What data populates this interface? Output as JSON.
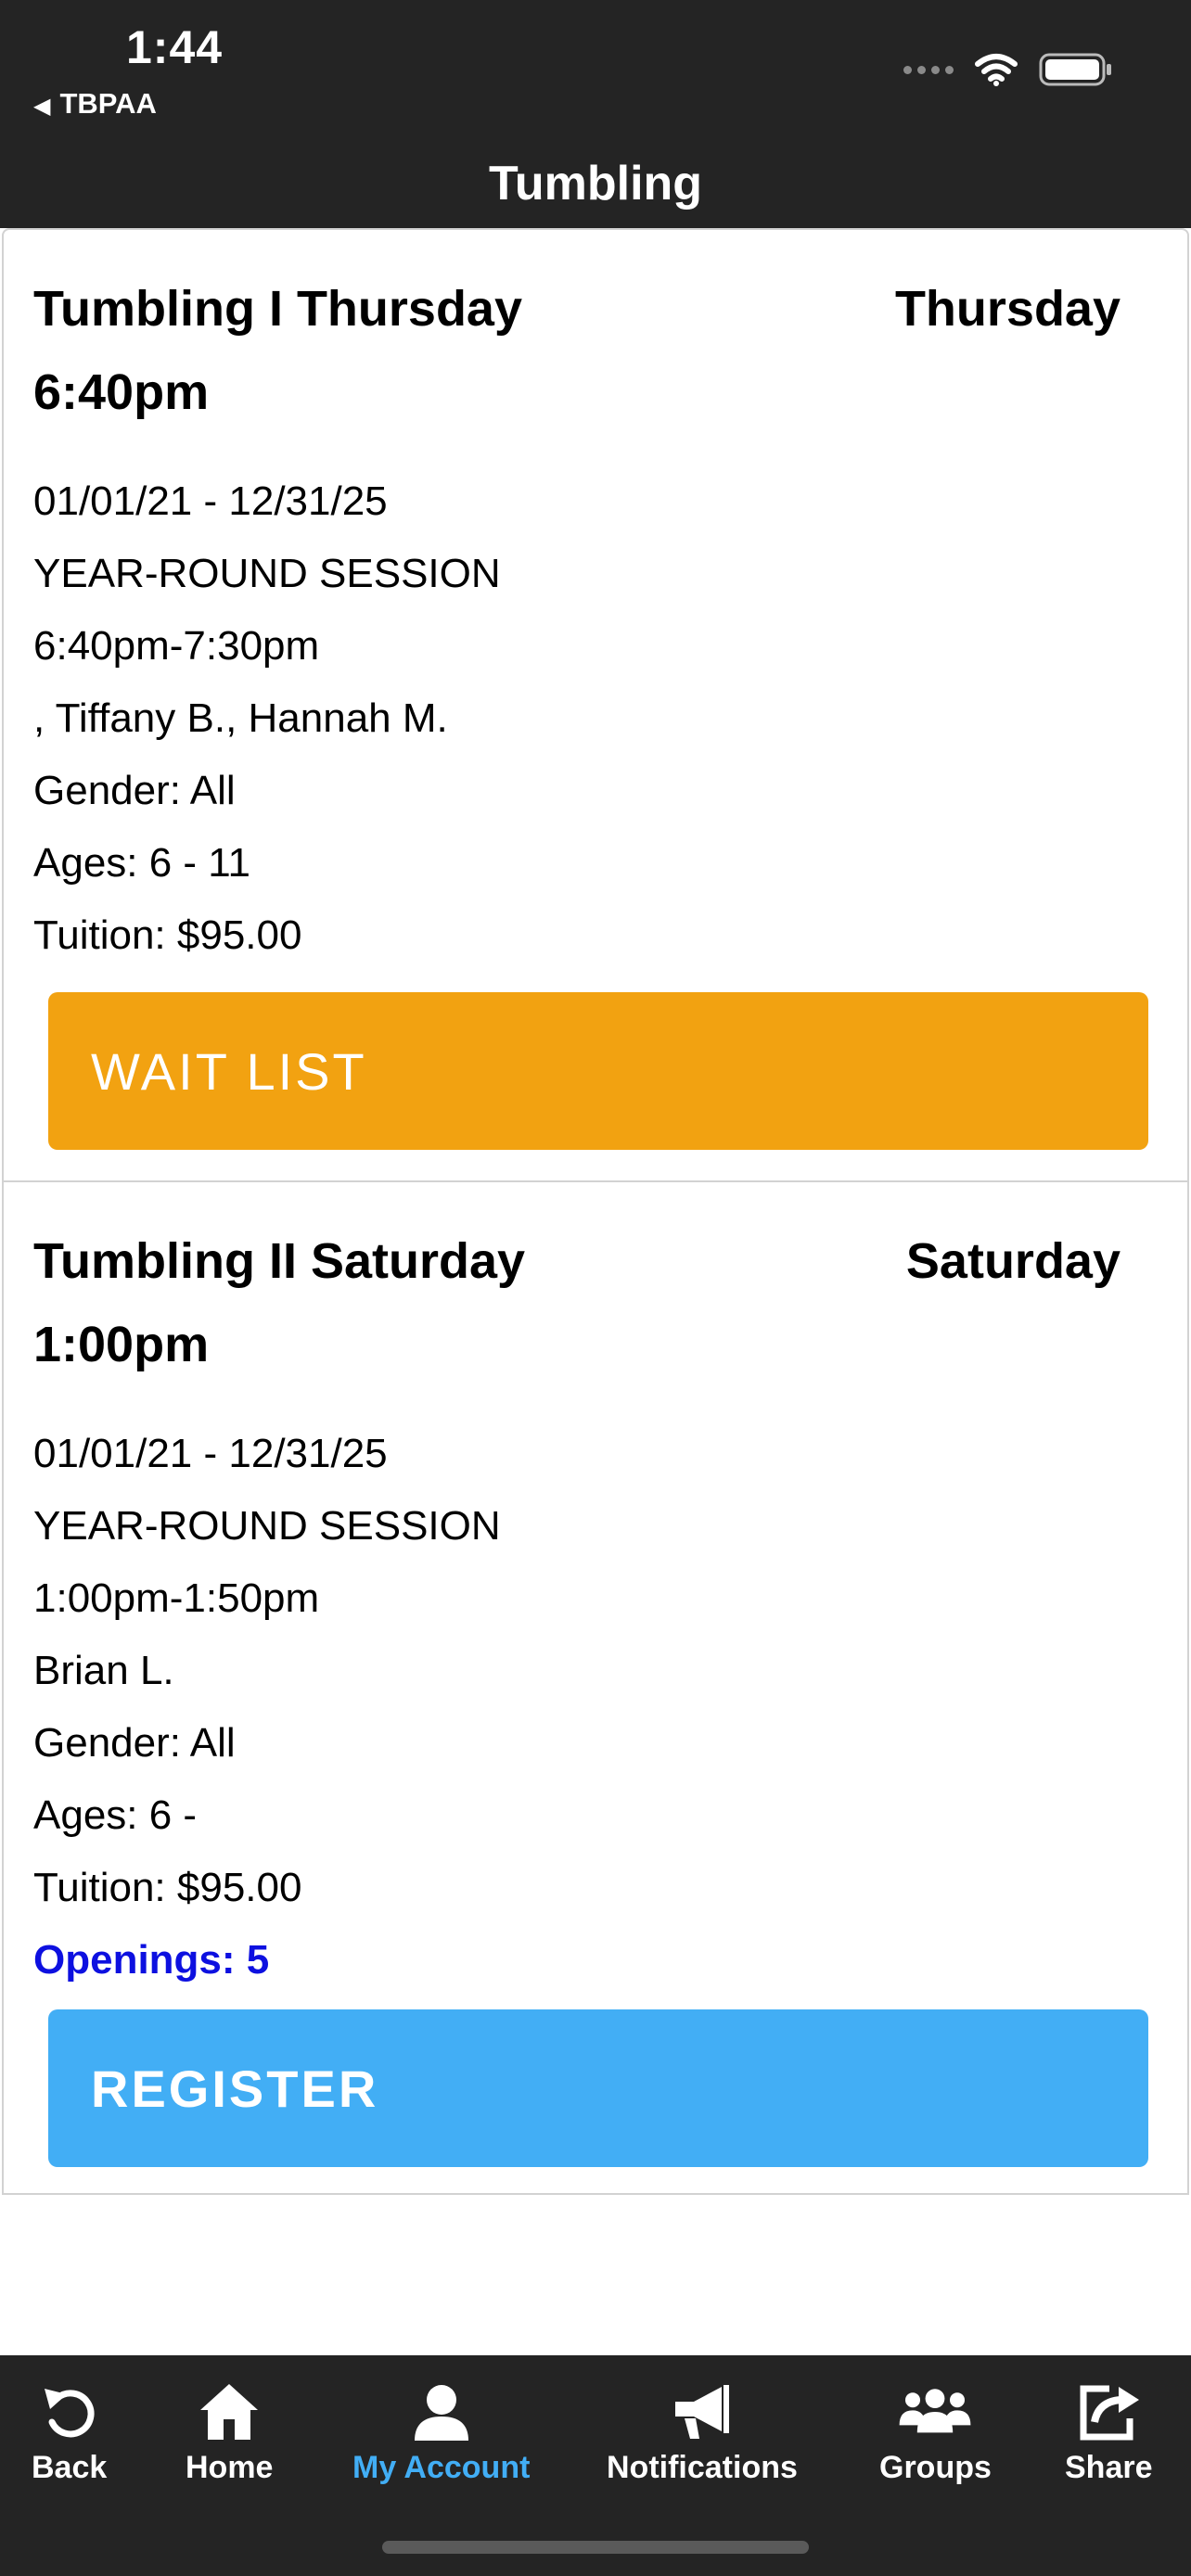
{
  "status": {
    "time": "1:44",
    "back_app": "TBPAA"
  },
  "nav": {
    "title": "Tumbling"
  },
  "classes": [
    {
      "title": "Tumbling I Thursday 6:40pm",
      "day": "Thursday",
      "dates": "01/01/21 - 12/31/25",
      "session": "YEAR-ROUND SESSION",
      "time_range": "6:40pm-7:30pm",
      "instructors": ", Tiffany B., Hannah M.",
      "gender": "Gender: All",
      "ages": "Ages: 6 - 11",
      "tuition": "Tuition: $95.00",
      "button_label": "WAIT LIST"
    },
    {
      "title": "Tumbling II Saturday 1:00pm",
      "day": "Saturday",
      "dates": "01/01/21 - 12/31/25",
      "session": "YEAR-ROUND SESSION",
      "time_range": "1:00pm-1:50pm",
      "instructors": "Brian L.",
      "gender": "Gender: All",
      "ages": "Ages: 6 -",
      "tuition": "Tuition: $95.00",
      "openings": "Openings: 5",
      "button_label": "REGISTER"
    }
  ],
  "tabs": [
    {
      "label": "Back",
      "icon": "back-arrow-icon"
    },
    {
      "label": "Home",
      "icon": "home-icon"
    },
    {
      "label": "My Account",
      "icon": "user-icon",
      "active": true
    },
    {
      "label": "Notifications",
      "icon": "megaphone-icon"
    },
    {
      "label": "Groups",
      "icon": "groups-icon"
    },
    {
      "label": "Share",
      "icon": "share-icon"
    }
  ],
  "colors": {
    "bar_bg": "#242424",
    "wait_list": "#f2a211",
    "register": "#42aef5",
    "openings": "#0d10e0",
    "active_tab": "#42aef5"
  }
}
